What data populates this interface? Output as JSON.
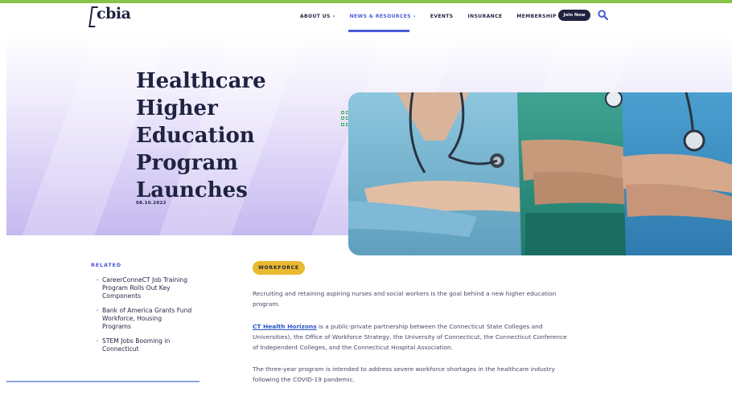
{
  "brand": {
    "logo_text": "cbia"
  },
  "nav": {
    "items": [
      {
        "label": "ABOUT US",
        "chevron": true,
        "active": false
      },
      {
        "label": "NEWS & RESOURCES",
        "chevron": true,
        "active": true
      },
      {
        "label": "EVENTS",
        "chevron": false,
        "active": false
      },
      {
        "label": "INSURANCE",
        "chevron": false,
        "active": false
      },
      {
        "label": "MEMBERSHIP",
        "chevron": true,
        "active": false
      }
    ],
    "join_label": "Join Now",
    "search_icon": "search-icon"
  },
  "hero": {
    "title_lines": [
      "Healthcare",
      "Higher",
      "Education",
      "Program",
      "Launches"
    ],
    "date": "08.10.2022",
    "image": "healthcare-workers-crossed-arms-photo"
  },
  "related": {
    "heading": "RELATED",
    "items": [
      "CareerConneCT Job Training Program Rolls Out Key Components",
      "Bank of America Grants Fund Workforce, Housing Programs",
      "STEM Jobs Booming in Connecticut"
    ]
  },
  "article": {
    "tag": "WORKFORCE",
    "p1": "Recruiting and retaining aspiring nurses and social workers is the goal behind a new higher education program.",
    "p2_link": "CT Health Horizons",
    "p2_rest": " is a public-private partnership between the Connecticut State Colleges and Universities), the Office of Workforce Strategy, the University of Connecticut, the Connecticut Conference of Independent Colleges, and the Connecticut Hospital Association.",
    "p3": "The three-year program is intended to address severe workforce shortages in the healthcare industry following the COVID-19 pandemic."
  },
  "colors": {
    "accent_green": "#8ac24a",
    "nav_active": "#4a5bd6",
    "navy": "#1f2340",
    "tag_yellow": "#e9b92f",
    "hero_lavender": "#c5b8f0"
  }
}
